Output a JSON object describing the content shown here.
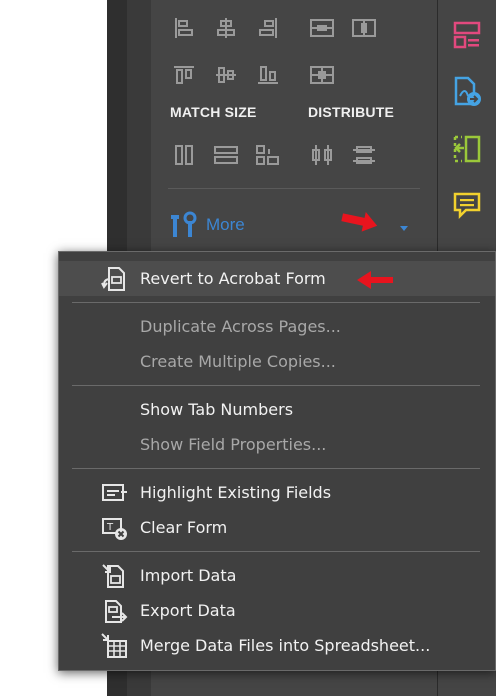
{
  "panel": {
    "sections": {
      "match_size": "MATCH SIZE",
      "distribute": "DISTRIBUTE"
    },
    "more_label": "More",
    "icons": {
      "align_row_1": [
        "align-left-icon",
        "align-center-horizontal-icon",
        "align-right-icon",
        "center-horizontal-icon",
        "center-vertical-icon"
      ],
      "align_row_2": [
        "align-top-icon",
        "align-middle-icon",
        "align-bottom-icon",
        "center-both-icon"
      ],
      "match_size": [
        "match-width-icon",
        "match-height-icon",
        "match-both-icon"
      ],
      "distribute": [
        "distribute-horizontal-icon",
        "distribute-vertical-icon"
      ]
    }
  },
  "right_rail": {
    "icons": [
      "prepare-form-icon",
      "export-pdf-icon",
      "organize-pages-icon",
      "comment-icon"
    ],
    "colors": [
      "#e2497e",
      "#45a3e3",
      "#9bc83a",
      "#f2d12e"
    ]
  },
  "menu": {
    "items": [
      {
        "label": "Revert to Acrobat Form",
        "icon": "revert-form-icon",
        "enabled": true,
        "highlighted": true
      },
      {
        "label": "Duplicate Across Pages...",
        "icon": "",
        "enabled": false
      },
      {
        "label": "Create Multiple Copies...",
        "icon": "",
        "enabled": false
      },
      {
        "label": "Show Tab Numbers",
        "icon": "",
        "enabled": true
      },
      {
        "label": "Show Field Properties...",
        "icon": "",
        "enabled": false
      },
      {
        "label": "Highlight Existing Fields",
        "icon": "highlight-fields-icon",
        "enabled": true
      },
      {
        "label": "Clear Form",
        "icon": "clear-form-icon",
        "enabled": true
      },
      {
        "label": "Import Data",
        "icon": "import-data-icon",
        "enabled": true
      },
      {
        "label": "Export Data",
        "icon": "export-data-icon",
        "enabled": true
      },
      {
        "label": "Merge Data Files into Spreadsheet...",
        "icon": "merge-spreadsheet-icon",
        "enabled": true
      }
    ]
  },
  "colors": {
    "accent_blue": "#3c86d3",
    "annotation_red": "#e8141e"
  }
}
